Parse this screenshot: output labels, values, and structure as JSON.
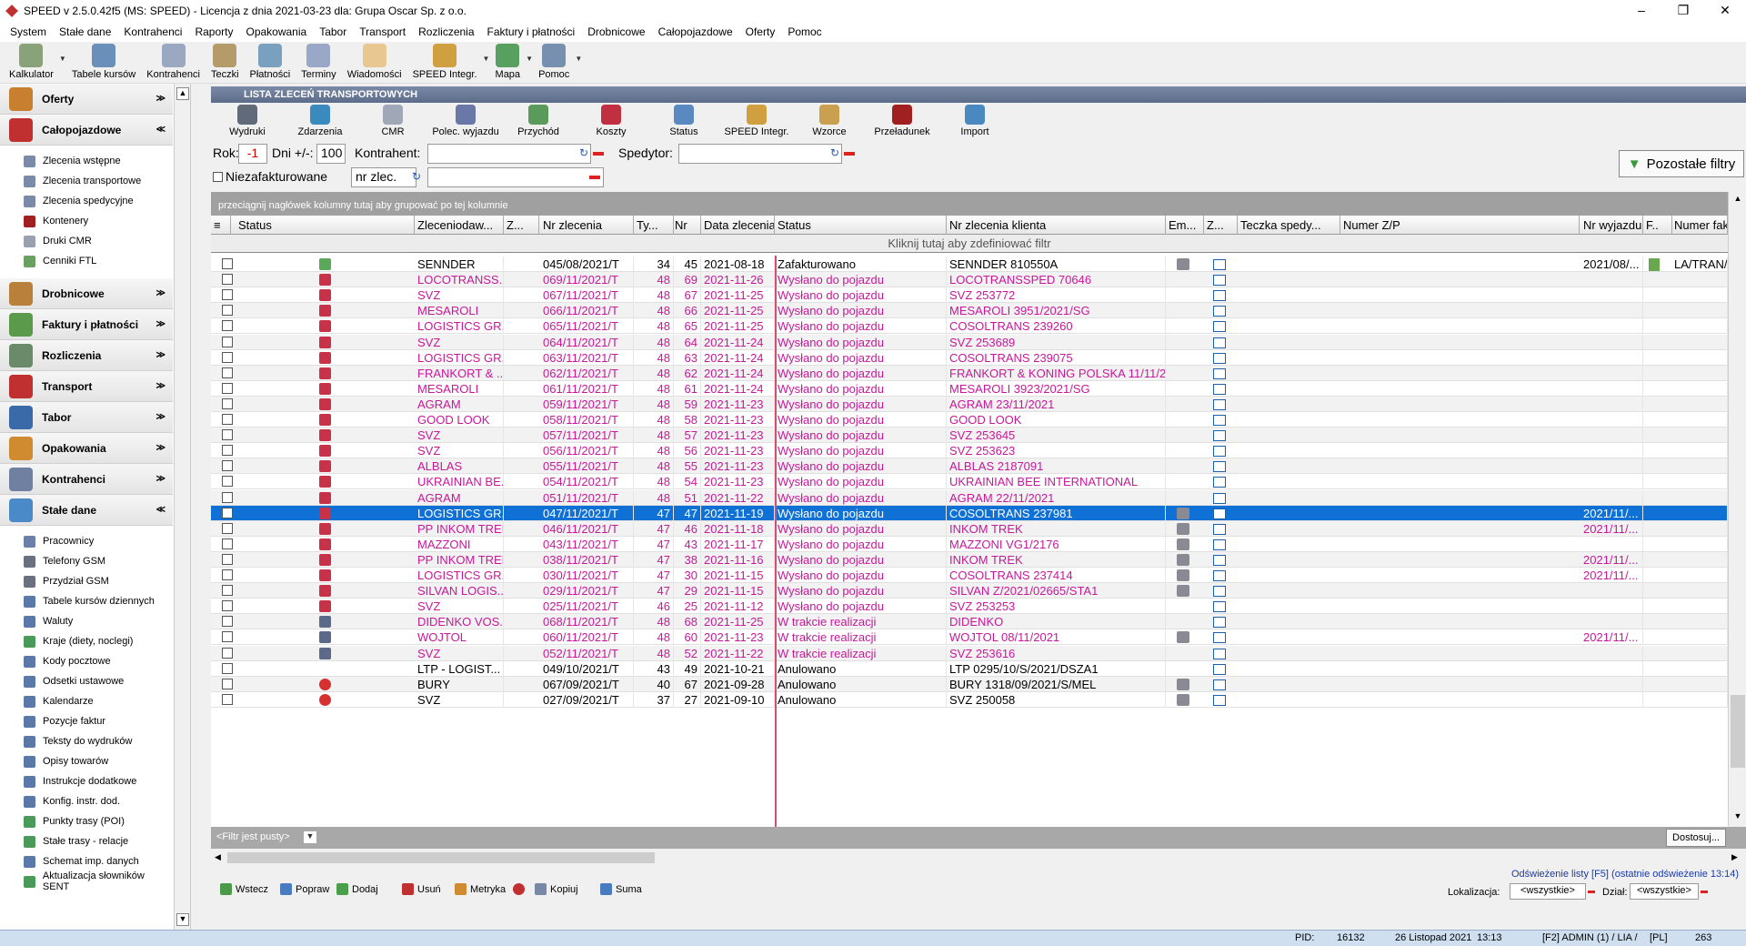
{
  "window": {
    "title": "SPEED v 2.5.0.42f5 (MS: SPEED) - Licencja z dnia 2021-03-23 dla: Grupa Oscar Sp. z o.o.",
    "minimize": "–",
    "restore": "❐",
    "close": "✕"
  },
  "menu": [
    "System",
    "Stałe dane",
    "Kontrahenci",
    "Raporty",
    "Opakowania",
    "Tabor",
    "Transport",
    "Rozliczenia",
    "Faktury i płatności",
    "Drobnicowe",
    "Całopojazdowe",
    "Oferty",
    "Pomoc"
  ],
  "toolbar": [
    {
      "label": "Kalkulator",
      "color": "#8aa27a"
    },
    {
      "label": "Tabele kursów",
      "color": "#6a8fb8"
    },
    {
      "label": "Kontrahenci",
      "color": "#9aa8c2"
    },
    {
      "label": "Teczki",
      "color": "#b59a6a"
    },
    {
      "label": "Płatności",
      "color": "#7aa0c0"
    },
    {
      "label": "Terminy",
      "color": "#9aa8c8"
    },
    {
      "label": "Wiadomości",
      "color": "#e8c890"
    },
    {
      "label": "SPEED Integr.",
      "color": "#d0a040"
    },
    {
      "label": "Mapa",
      "color": "#58a060"
    },
    {
      "label": "Pomoc",
      "color": "#7890b0"
    }
  ],
  "sidebar": {
    "groups_top": [
      {
        "label": "Oferty",
        "color": "#c88030",
        "chev": "≫"
      },
      {
        "label": "Całopojazdowe",
        "color": "#c03030",
        "chev": "≪"
      }
    ],
    "items_calo": [
      {
        "label": "Zlecenia wstępne",
        "color": "#7a8aa8"
      },
      {
        "label": "Zlecenia transportowe",
        "color": "#7a8aa8"
      },
      {
        "label": "Zlecenia spedycyjne",
        "color": "#7a8aa8"
      },
      {
        "label": "Kontenery",
        "color": "#a02020"
      },
      {
        "label": "Druki CMR",
        "color": "#9aa0b0"
      },
      {
        "label": "Cenniki FTL",
        "color": "#6aa060"
      }
    ],
    "groups_mid": [
      {
        "label": "Drobnicowe",
        "color": "#b8803a",
        "chev": "≫"
      },
      {
        "label": "Faktury i płatności",
        "color": "#5a9a4a",
        "chev": "≫"
      },
      {
        "label": "Rozliczenia",
        "color": "#6a8a6a",
        "chev": "≫"
      },
      {
        "label": "Transport",
        "color": "#c03030",
        "chev": "≫"
      },
      {
        "label": "Tabor",
        "color": "#3a6aa8",
        "chev": "≫"
      },
      {
        "label": "Opakowania",
        "color": "#d08a30",
        "chev": "≫"
      },
      {
        "label": "Kontrahenci",
        "color": "#7080a0",
        "chev": "≫"
      },
      {
        "label": "Stałe dane",
        "color": "#4a8ac8",
        "chev": "≪"
      }
    ],
    "items_stale": [
      {
        "label": "Pracownicy",
        "color": "#6a80a8"
      },
      {
        "label": "Telefony GSM",
        "color": "#6a7080"
      },
      {
        "label": "Przydział GSM",
        "color": "#6a7080"
      },
      {
        "label": "Tabele kursów dziennych",
        "color": "#5a78a8"
      },
      {
        "label": "Waluty",
        "color": "#5a78a8"
      },
      {
        "label": "Kraje (diety, noclegi)",
        "color": "#4a9a5a"
      },
      {
        "label": "Kody pocztowe",
        "color": "#5a78a8"
      },
      {
        "label": "Odsetki ustawowe",
        "color": "#5a78a8"
      },
      {
        "label": "Kalendarze",
        "color": "#5a78a8"
      },
      {
        "label": "Pozycje faktur",
        "color": "#5a78a8"
      },
      {
        "label": "Teksty do wydruków",
        "color": "#5a78a8"
      },
      {
        "label": "Opisy towarów",
        "color": "#5a78a8"
      },
      {
        "label": "Instrukcje dodatkowe",
        "color": "#5a78a8"
      },
      {
        "label": "Konfig. instr. dod.",
        "color": "#5a78a8"
      },
      {
        "label": "Punkty trasy (POI)",
        "color": "#4a9a5a"
      },
      {
        "label": "Stałe trasy - relacje",
        "color": "#4a9a5a"
      },
      {
        "label": "Schemat imp. danych",
        "color": "#5a78a8"
      },
      {
        "label": "Aktualizacja słowników SENT",
        "color": "#4a9a5a"
      }
    ]
  },
  "panel": {
    "title": "LISTA ZLECEŃ TRANSPORTOWYCH",
    "toolbar": [
      {
        "label": "Wydruki",
        "color": "#606a78"
      },
      {
        "label": "Zdarzenia",
        "color": "#3a8ac0"
      },
      {
        "label": "CMR",
        "color": "#a0a8b8"
      },
      {
        "label": "Polec. wyjazdu",
        "color": "#6a78a8"
      },
      {
        "label": "Przychód",
        "color": "#5a9a5a"
      },
      {
        "label": "Koszty",
        "color": "#c03040"
      },
      {
        "label": "Status",
        "color": "#5a88c0"
      },
      {
        "label": "SPEED Integr.",
        "color": "#d0a040"
      },
      {
        "label": "Wzorce",
        "color": "#c8a050"
      },
      {
        "label": "Przeładunek",
        "color": "#a02020"
      },
      {
        "label": "Import",
        "color": "#4a88c0"
      }
    ]
  },
  "filters": {
    "rok_label": "Rok:",
    "rok_value": "-1",
    "dni_label": "Dni +/-:",
    "dni_value": "100",
    "kontrahent_label": "Kontrahent:",
    "spedytor_label": "Spedytor:",
    "niezafakturowane_label": "Niezafakturowane",
    "nr_zlec_value": "nr zlec.",
    "pozostale_label": "Pozostałe filtry"
  },
  "grid": {
    "group_hint": "przeciągnij nagłówek kolumny tutaj aby grupować po tej kolumnie",
    "filter_hint": "Kliknij tutaj aby zdefiniować filtr",
    "columns": [
      "Status",
      "Zleceniodaw...",
      "Z...",
      "Nr zlecenia",
      "Ty...",
      "Nr",
      "Data zlecenia",
      "Status",
      "Nr zlecenia klienta",
      "Em...",
      "Z...",
      "Teczka spedy...",
      "Numer Z/P",
      "Nr wyjazdu",
      "F..",
      "Numer fak"
    ],
    "rows": [
      {
        "icon": "done",
        "client": "SENNDER",
        "nr": "045/08/2021/T",
        "typ": "34",
        "n": "45",
        "date": "2021-08-18",
        "status": "Zafakturowano",
        "clientnr": "SENNDER 810550A",
        "em": true,
        "wyjazd": "2021/08/...",
        "f": true,
        "fak": "LA/TRAN/F",
        "color": "#000000"
      },
      {
        "icon": "sent",
        "client": "LOCOTRANSS...",
        "nr": "069/11/2021/T",
        "typ": "48",
        "n": "69",
        "date": "2021-11-26",
        "status": "Wysłano do pojazdu",
        "clientnr": "LOCOTRANSSPED 70646",
        "em": false,
        "wyjazd": "",
        "f": false,
        "fak": "",
        "color": "#c8189a"
      },
      {
        "icon": "sent",
        "client": "SVZ",
        "nr": "067/11/2021/T",
        "typ": "48",
        "n": "67",
        "date": "2021-11-25",
        "status": "Wysłano do pojazdu",
        "clientnr": "SVZ 253772",
        "em": false,
        "wyjazd": "",
        "f": false,
        "fak": "",
        "color": "#c8189a"
      },
      {
        "icon": "sent",
        "client": "MESAROLI",
        "nr": "066/11/2021/T",
        "typ": "48",
        "n": "66",
        "date": "2021-11-25",
        "status": "Wysłano do pojazdu",
        "clientnr": "MESAROLI  3951/2021/SG",
        "em": false,
        "wyjazd": "",
        "f": false,
        "fak": "",
        "color": "#c8189a"
      },
      {
        "icon": "sent",
        "client": "LOGISTICS GR...",
        "nr": "065/11/2021/T",
        "typ": "48",
        "n": "65",
        "date": "2021-11-25",
        "status": "Wysłano do pojazdu",
        "clientnr": "COSOLTRANS 239260",
        "em": false,
        "wyjazd": "",
        "f": false,
        "fak": "",
        "color": "#c8189a"
      },
      {
        "icon": "sent",
        "client": "SVZ",
        "nr": "064/11/2021/T",
        "typ": "48",
        "n": "64",
        "date": "2021-11-24",
        "status": "Wysłano do pojazdu",
        "clientnr": "SVZ 253689",
        "em": false,
        "wyjazd": "",
        "f": false,
        "fak": "",
        "color": "#c8189a"
      },
      {
        "icon": "sent",
        "client": "LOGISTICS GR...",
        "nr": "063/11/2021/T",
        "typ": "48",
        "n": "63",
        "date": "2021-11-24",
        "status": "Wysłano do pojazdu",
        "clientnr": "COSOLTRANS 239075",
        "em": false,
        "wyjazd": "",
        "f": false,
        "fak": "",
        "color": "#c8189a"
      },
      {
        "icon": "sent",
        "client": "FRANKORT & ...",
        "nr": "062/11/2021/T",
        "typ": "48",
        "n": "62",
        "date": "2021-11-24",
        "status": "Wysłano do pojazdu",
        "clientnr": "FRANKORT & KONING POLSKA 11/11/2...",
        "em": false,
        "wyjazd": "",
        "f": false,
        "fak": "",
        "color": "#c8189a"
      },
      {
        "icon": "sent",
        "client": "MESAROLI",
        "nr": "061/11/2021/T",
        "typ": "48",
        "n": "61",
        "date": "2021-11-24",
        "status": "Wysłano do pojazdu",
        "clientnr": "MESAROLI 3923/2021/SG",
        "em": false,
        "wyjazd": "",
        "f": false,
        "fak": "",
        "color": "#c8189a"
      },
      {
        "icon": "sent",
        "client": "AGRAM",
        "nr": "059/11/2021/T",
        "typ": "48",
        "n": "59",
        "date": "2021-11-23",
        "status": "Wysłano do pojazdu",
        "clientnr": "AGRAM 23/11/2021",
        "em": false,
        "wyjazd": "",
        "f": false,
        "fak": "",
        "color": "#c8189a"
      },
      {
        "icon": "sent",
        "client": "GOOD LOOK",
        "nr": "058/11/2021/T",
        "typ": "48",
        "n": "58",
        "date": "2021-11-23",
        "status": "Wysłano do pojazdu",
        "clientnr": "GOOD LOOK",
        "em": false,
        "wyjazd": "",
        "f": false,
        "fak": "",
        "color": "#c8189a"
      },
      {
        "icon": "sent",
        "client": "SVZ",
        "nr": "057/11/2021/T",
        "typ": "48",
        "n": "57",
        "date": "2021-11-23",
        "status": "Wysłano do pojazdu",
        "clientnr": "SVZ 253645",
        "em": false,
        "wyjazd": "",
        "f": false,
        "fak": "",
        "color": "#c8189a"
      },
      {
        "icon": "sent",
        "client": "SVZ",
        "nr": "056/11/2021/T",
        "typ": "48",
        "n": "56",
        "date": "2021-11-23",
        "status": "Wysłano do pojazdu",
        "clientnr": "SVZ 253623",
        "em": false,
        "wyjazd": "",
        "f": false,
        "fak": "",
        "color": "#c8189a"
      },
      {
        "icon": "sent",
        "client": "ALBLAS",
        "nr": "055/11/2021/T",
        "typ": "48",
        "n": "55",
        "date": "2021-11-23",
        "status": "Wysłano do pojazdu",
        "clientnr": "ALBLAS 2187091",
        "em": false,
        "wyjazd": "",
        "f": false,
        "fak": "",
        "color": "#c8189a"
      },
      {
        "icon": "sent",
        "client": "UKRAINIAN BE...",
        "nr": "054/11/2021/T",
        "typ": "48",
        "n": "54",
        "date": "2021-11-23",
        "status": "Wysłano do pojazdu",
        "clientnr": "UKRAINIAN BEE INTERNATIONAL",
        "em": false,
        "wyjazd": "",
        "f": false,
        "fak": "",
        "color": "#c8189a"
      },
      {
        "icon": "sent",
        "client": "AGRAM",
        "nr": "051/11/2021/T",
        "typ": "48",
        "n": "51",
        "date": "2021-11-22",
        "status": "Wysłano do pojazdu",
        "clientnr": "AGRAM 22/11/2021",
        "em": false,
        "wyjazd": "",
        "f": false,
        "fak": "",
        "color": "#c8189a"
      },
      {
        "icon": "sent",
        "client": "LOGISTICS GR...",
        "nr": "047/11/2021/T",
        "typ": "47",
        "n": "47",
        "date": "2021-11-19",
        "status": "Wysłano do pojazdu",
        "clientnr": "COSOLTRANS 237981",
        "em": true,
        "wyjazd": "2021/11/...",
        "f": false,
        "fak": "",
        "color": "#c8189a",
        "selected": true
      },
      {
        "icon": "sent",
        "client": "PP INKOM TREK",
        "nr": "046/11/2021/T",
        "typ": "47",
        "n": "46",
        "date": "2021-11-18",
        "status": "Wysłano do pojazdu",
        "clientnr": "INKOM TREK",
        "em": true,
        "wyjazd": "2021/11/...",
        "f": false,
        "fak": "",
        "color": "#c8189a"
      },
      {
        "icon": "sent",
        "client": "MAZZONI",
        "nr": "043/11/2021/T",
        "typ": "47",
        "n": "43",
        "date": "2021-11-17",
        "status": "Wysłano do pojazdu",
        "clientnr": "MAZZONI VG1/2176",
        "em": true,
        "wyjazd": "",
        "f": false,
        "fak": "",
        "color": "#c8189a"
      },
      {
        "icon": "sent",
        "client": "PP INKOM TREK",
        "nr": "038/11/2021/T",
        "typ": "47",
        "n": "38",
        "date": "2021-11-16",
        "status": "Wysłano do pojazdu",
        "clientnr": "INKOM TREK",
        "em": true,
        "wyjazd": "2021/11/...",
        "f": false,
        "fak": "",
        "color": "#c8189a"
      },
      {
        "icon": "sent",
        "client": "LOGISTICS GR...",
        "nr": "030/11/2021/T",
        "typ": "47",
        "n": "30",
        "date": "2021-11-15",
        "status": "Wysłano do pojazdu",
        "clientnr": "COSOLTRANS 237414",
        "em": true,
        "wyjazd": "2021/11/...",
        "f": false,
        "fak": "",
        "color": "#c8189a"
      },
      {
        "icon": "sent",
        "client": "SILVAN LOGIS...",
        "nr": "029/11/2021/T",
        "typ": "47",
        "n": "29",
        "date": "2021-11-15",
        "status": "Wysłano do pojazdu",
        "clientnr": "SILVAN  Z/2021/02665/STA1",
        "em": true,
        "wyjazd": "",
        "f": false,
        "fak": "",
        "color": "#c8189a"
      },
      {
        "icon": "sent",
        "client": "SVZ",
        "nr": "025/11/2021/T",
        "typ": "46",
        "n": "25",
        "date": "2021-11-12",
        "status": "Wysłano do pojazdu",
        "clientnr": "SVZ 253253",
        "em": false,
        "wyjazd": "",
        "f": false,
        "fak": "",
        "color": "#c8189a"
      },
      {
        "icon": "truck",
        "client": "DIDENKO VOS...",
        "nr": "068/11/2021/T",
        "typ": "48",
        "n": "68",
        "date": "2021-11-25",
        "status": "W trakcie realizacji",
        "clientnr": "DIDENKO",
        "em": false,
        "wyjazd": "",
        "f": false,
        "fak": "",
        "color": "#c8189a"
      },
      {
        "icon": "truck",
        "client": "WOJTOL",
        "nr": "060/11/2021/T",
        "typ": "48",
        "n": "60",
        "date": "2021-11-23",
        "status": "W trakcie realizacji",
        "clientnr": "WOJTOL 08/11/2021",
        "em": true,
        "wyjazd": "2021/11/...",
        "f": false,
        "fak": "",
        "color": "#c8189a"
      },
      {
        "icon": "truck",
        "client": "SVZ",
        "nr": "052/11/2021/T",
        "typ": "48",
        "n": "52",
        "date": "2021-11-22",
        "status": "W trakcie realizacji",
        "clientnr": "SVZ 253616",
        "em": false,
        "wyjazd": "",
        "f": false,
        "fak": "",
        "color": "#c8189a"
      },
      {
        "icon": "none",
        "client": "LTP - LOGIST...",
        "nr": "049/10/2021/T",
        "typ": "43",
        "n": "49",
        "date": "2021-10-21",
        "status": "Anulowano",
        "clientnr": "LTP 0295/10/S/2021/DSZA1",
        "em": false,
        "wyjazd": "",
        "f": false,
        "fak": "",
        "color": "#000000"
      },
      {
        "icon": "cancel",
        "client": "BURY",
        "nr": "067/09/2021/T",
        "typ": "40",
        "n": "67",
        "date": "2021-09-28",
        "status": "Anulowano",
        "clientnr": "BURY  1318/09/2021/S/MEL",
        "em": true,
        "wyjazd": "",
        "f": false,
        "fak": "",
        "color": "#000000"
      },
      {
        "icon": "cancel",
        "client": "SVZ",
        "nr": "027/09/2021/T",
        "typ": "37",
        "n": "27",
        "date": "2021-09-10",
        "status": "Anulowano",
        "clientnr": "SVZ 250058",
        "em": true,
        "wyjazd": "",
        "f": false,
        "fak": "",
        "color": "#000000"
      }
    ],
    "filter_empty": "<Filtr jest pusty>",
    "dostosuj": "Dostosuj..."
  },
  "bottom": {
    "buttons": [
      {
        "label": "Wstecz",
        "color": "#4a9a4a"
      },
      {
        "label": "Popraw",
        "color": "#4a7ac0"
      },
      {
        "label": "Dodaj",
        "color": "#4aa04a"
      },
      {
        "label": "Usuń",
        "color": "#c03030"
      },
      {
        "label": "Metryka",
        "color": "#d08a30"
      },
      {
        "label": "",
        "color": "#c03030"
      },
      {
        "label": "Kopiuj",
        "color": "#7a88a8"
      },
      {
        "label": "Suma",
        "color": "#4a7ac0"
      }
    ],
    "refresh": "Odświeżenie listy [F5]  (ostatnie odświeżenie 13:14)",
    "lokalizacja_label": "Lokalizacja:",
    "lokalizacja_value": "<wszystkie>",
    "dzial_label": "Dział:",
    "dzial_value": "<wszystkie>"
  },
  "status": {
    "pid_label": "PID:",
    "pid": "16132",
    "date": "26 Listopad 2021",
    "time": "13:13",
    "user": "[F2]  ADMIN (1) / LIA /",
    "lang": "[PL]",
    "num": "263"
  },
  "icon_colors": {
    "done": "#5aa85a",
    "sent": "#c83248",
    "truck": "#5a6a88",
    "cancel": "#d63030",
    "none": "transparent"
  }
}
